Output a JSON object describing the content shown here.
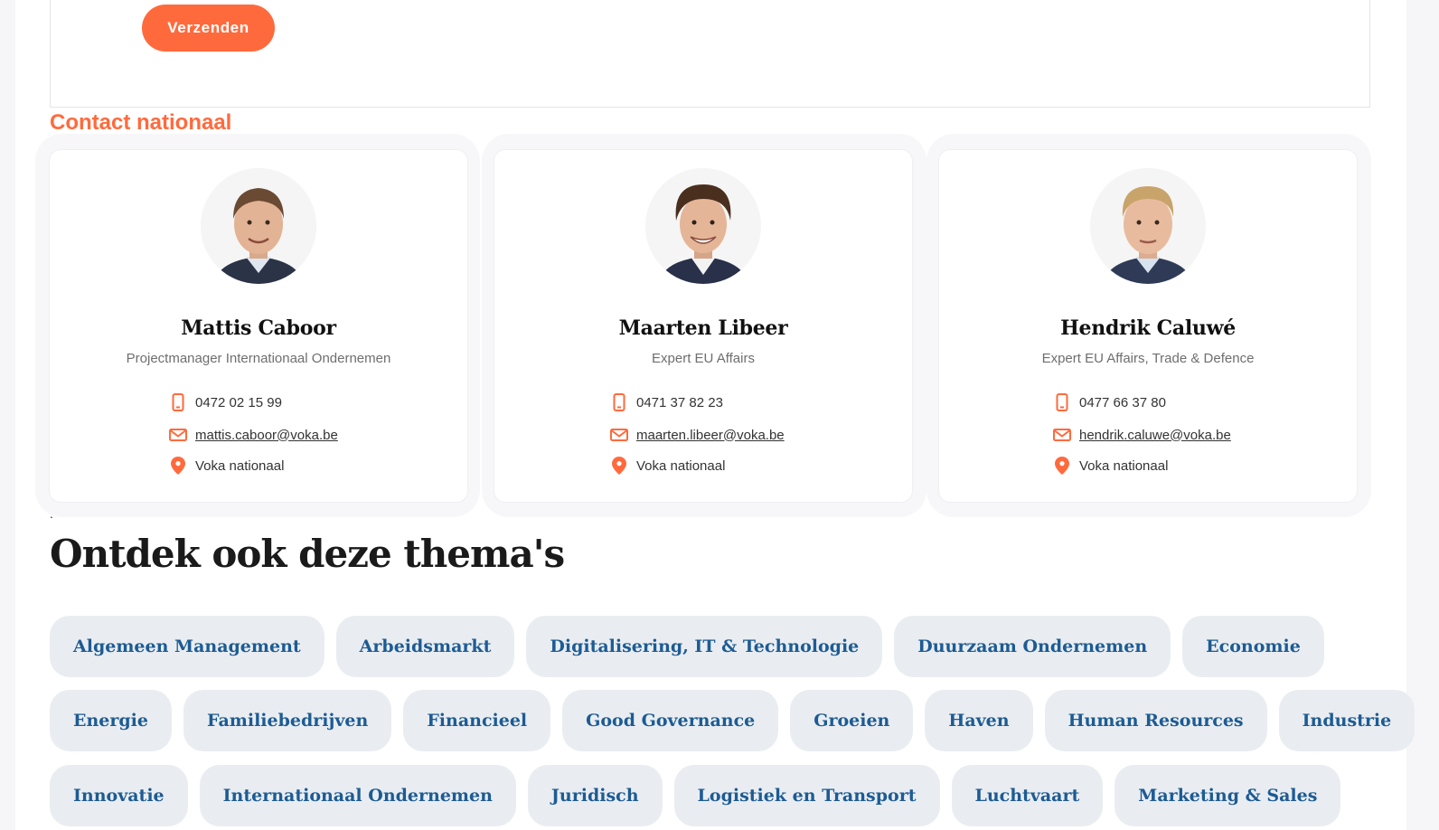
{
  "form": {
    "submit_label": "Verzenden"
  },
  "contact_section": {
    "title": "Contact nationaal",
    "contacts": [
      {
        "name": "Mattis Caboor",
        "role": "Projectmanager Internationaal Ondernemen",
        "phone": "0472 02 15 99",
        "email": "mattis.caboor@voka.be",
        "location": "Voka nationaal"
      },
      {
        "name": "Maarten Libeer",
        "role": "Expert EU Affairs",
        "phone": "0471 37 82 23",
        "email": "maarten.libeer@voka.be",
        "location": "Voka nationaal"
      },
      {
        "name": "Hendrik Caluwé",
        "role": "Expert EU Affairs, Trade & Defence",
        "phone": "0477 66 37 80",
        "email": "hendrik.caluwe@voka.be",
        "location": "Voka nationaal"
      }
    ]
  },
  "stray_mark": ".",
  "themes": {
    "heading": "Ontdek ook deze thema's",
    "rows": [
      [
        "Algemeen Management",
        "Arbeidsmarkt",
        "Digitalisering, IT & Technologie",
        "Duurzaam Ondernemen",
        "Economie"
      ],
      [
        "Energie",
        "Familiebedrijven",
        "Financieel",
        "Good Governance",
        "Groeien",
        "Haven",
        "Human Resources",
        "Industrie"
      ],
      [
        "Innovatie",
        "Internationaal Ondernemen",
        "Juridisch",
        "Logistiek en Transport",
        "Luchtvaart",
        "Marketing & Sales"
      ]
    ]
  },
  "colors": {
    "accent": "#ff6a3d",
    "tag_bg": "#e9edf1",
    "tag_text": "#1d5b93"
  },
  "icons": {
    "phone": "mobile-phone-icon",
    "email": "envelope-icon",
    "location": "map-pin-icon"
  }
}
